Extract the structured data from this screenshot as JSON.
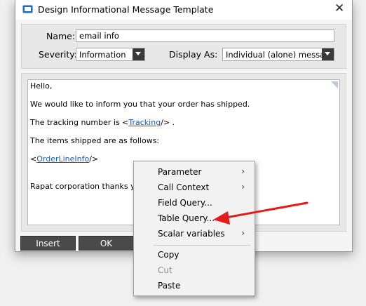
{
  "window": {
    "title": "Design Informational Message Template",
    "close_glyph": "✕"
  },
  "form": {
    "name_label": "Name:",
    "name_value": "email info",
    "severity_label": "Severity:",
    "severity_value": "Information",
    "display_as_label": "Display As:",
    "display_as_value": "Individual (alone) message"
  },
  "editor": {
    "line1": "Hello,",
    "line2": "We would like to inform you that your order has shipped.",
    "line3_prefix": "The tracking number is <",
    "line3_link": "Tracking",
    "line3_suffix": "/> .",
    "line4": "The items shipped are as follows:",
    "line5_prefix": "<",
    "line5_link": "OrderLineInfo",
    "line5_suffix": "/>",
    "line6": "Rapat corporation thanks you fo"
  },
  "buttons": {
    "insert": "Insert",
    "ok": "OK"
  },
  "context_menu": {
    "items": [
      {
        "label": "Parameter",
        "submenu": "›"
      },
      {
        "label": "Call Context",
        "submenu": "›"
      },
      {
        "label": "Field Query..."
      },
      {
        "label": "Table Query..."
      },
      {
        "label": "Scalar variables",
        "submenu": "›"
      },
      {
        "label": "Copy"
      },
      {
        "label": "Cut",
        "disabled": true
      },
      {
        "label": "Paste"
      }
    ]
  },
  "annotation": {
    "arrow_color": "#e31b1b",
    "points_to": "Table Query..."
  }
}
